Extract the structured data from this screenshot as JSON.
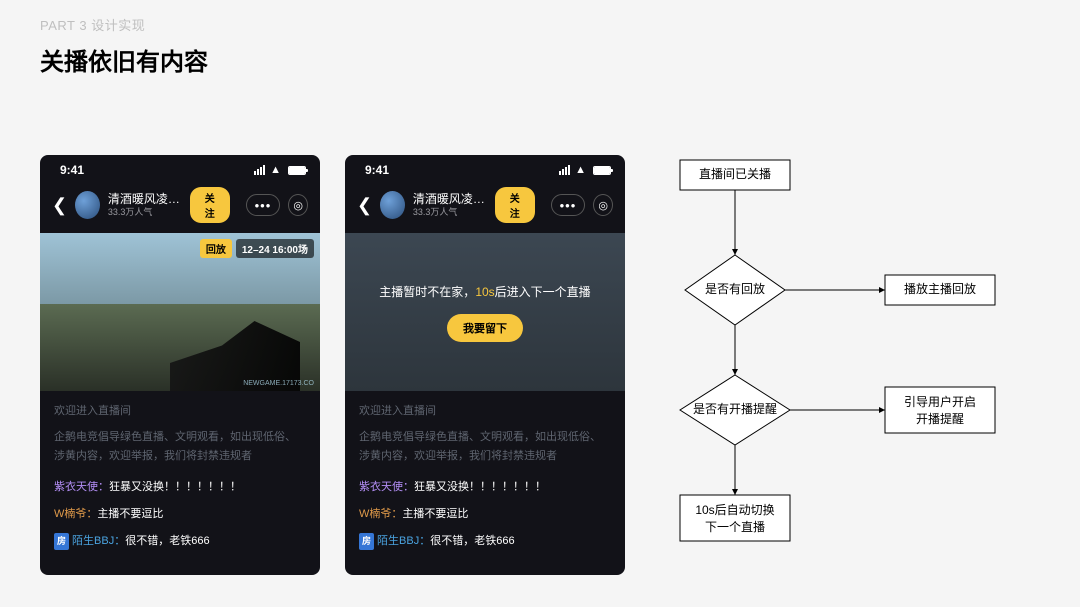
{
  "header": {
    "kicker": "PART 3 设计实现",
    "title": "关播依旧有内容"
  },
  "device": {
    "time": "9:41"
  },
  "app_header": {
    "streamer_name": "清酒暖风凌…",
    "popularity": "33.3万人气",
    "follow_label": "关注"
  },
  "badges": {
    "replay": "回放",
    "time_slot": "12–24 16:00场",
    "watermark": "NEWGAME.17173.CO"
  },
  "offline": {
    "pre": "主播暂时不在家，",
    "countdown": "10s",
    "post": "后进入下一个直播",
    "stay_label": "我要留下"
  },
  "chat": {
    "welcome": "欢迎进入直播间",
    "rules": "企鹅电竞倡导绿色直播、文明观看，如出现低俗、涉黄内容，欢迎举报，我们将封禁违规者",
    "line1_user": "紫衣天使：",
    "line1_msg": "狂暴又没换！！！！！！！",
    "line2_user": "W楠爷：",
    "line2_msg": "主播不要逗比",
    "line3_badge": "房",
    "line3_user": "陌生BBJ：",
    "line3_msg": "很不错，老铁666"
  },
  "flow": {
    "n1": "直播间已关播",
    "d1": "是否有回放",
    "d2": "是否有开播提醒",
    "r1": "播放主播回放",
    "r2a": "引导用户开启",
    "r2b": "开播提醒",
    "n_last_a": "10s后自动切换",
    "n_last_b": "下一个直播"
  }
}
